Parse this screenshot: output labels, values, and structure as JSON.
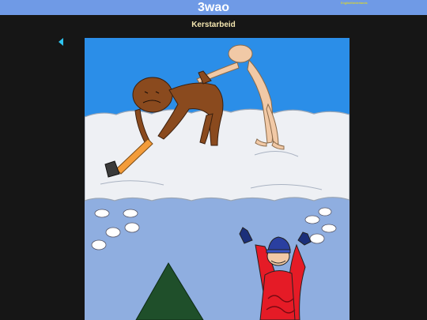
{
  "site": {
    "title": "3wao"
  },
  "languages": [
    {
      "label": "English"
    },
    {
      "label": "Nederlands"
    }
  ],
  "comic": {
    "title": "Kerstarbeid"
  },
  "colors": {
    "topbar": "#6f9ae6",
    "background": "#161616",
    "page_title": "#f4e6b0",
    "language_links": "#f2e200",
    "nav_arrow": "#2ec4f0"
  },
  "icons": {
    "previous": "triangle-left-icon"
  }
}
